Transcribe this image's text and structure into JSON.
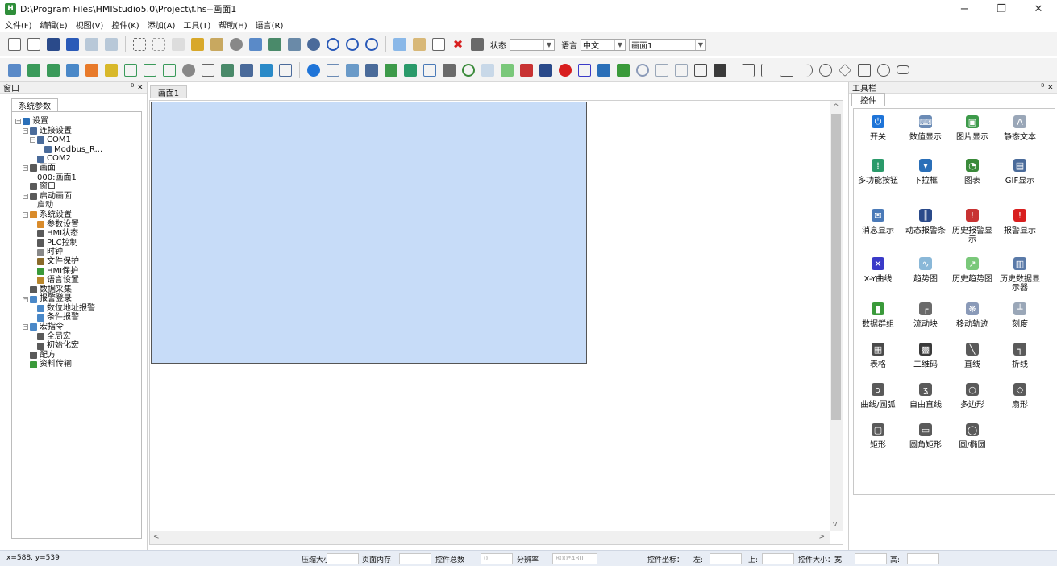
{
  "window": {
    "title": "D:\\Program Files\\HMIStudio5.0\\Project\\f.hs--画面1",
    "minimize": "−",
    "restore": "❐",
    "close": "✕"
  },
  "menu": [
    "文件(F)",
    "编辑(E)",
    "视图(V)",
    "控件(K)",
    "添加(A)",
    "工具(T)",
    "帮助(H)",
    "语言(R)"
  ],
  "toolbar1": {
    "state_label": "状态",
    "state_value": "",
    "lang_label": "语言",
    "lang_value": "中文",
    "screen_value": "画面1"
  },
  "left_panel": {
    "header": "窗口",
    "pin": "ᴮ ×",
    "tab": "系统参数",
    "tree": [
      {
        "label": "设置",
        "depth": 0,
        "exp": "−",
        "color": "#2a6fb8"
      },
      {
        "label": "连接设置",
        "depth": 1,
        "exp": "−",
        "color": "#4a6b9a"
      },
      {
        "label": "COM1",
        "depth": 2,
        "exp": "−",
        "color": "#4a6b9a"
      },
      {
        "label": "Modbus_R...",
        "depth": 3,
        "exp": "",
        "color": "#4a6b9a"
      },
      {
        "label": "COM2",
        "depth": 2,
        "exp": "",
        "color": "#4a6b9a"
      },
      {
        "label": "画面",
        "depth": 1,
        "exp": "−",
        "color": "#5a5a5a"
      },
      {
        "label": "000:画面1",
        "depth": 2,
        "exp": "",
        "color": ""
      },
      {
        "label": "窗口",
        "depth": 1,
        "exp": "",
        "color": "#5a5a5a"
      },
      {
        "label": "启动画面",
        "depth": 1,
        "exp": "−",
        "color": "#5a5a5a"
      },
      {
        "label": "启动",
        "depth": 2,
        "exp": "",
        "color": ""
      },
      {
        "label": "系统设置",
        "depth": 1,
        "exp": "−",
        "color": "#d98b2b"
      },
      {
        "label": "参数设置",
        "depth": 2,
        "exp": "",
        "color": "#d98b2b"
      },
      {
        "label": "HMI状态",
        "depth": 2,
        "exp": "",
        "color": "#5a5a5a"
      },
      {
        "label": "PLC控制",
        "depth": 2,
        "exp": "",
        "color": "#5a5a5a"
      },
      {
        "label": "时钟",
        "depth": 2,
        "exp": "",
        "color": "#888"
      },
      {
        "label": "文件保护",
        "depth": 2,
        "exp": "",
        "color": "#8a6a2a"
      },
      {
        "label": "HMI保护",
        "depth": 2,
        "exp": "",
        "color": "#3a9a3a"
      },
      {
        "label": "语言设置",
        "depth": 2,
        "exp": "",
        "color": "#b8862a"
      },
      {
        "label": "数据采集",
        "depth": 1,
        "exp": "",
        "color": "#5a5a5a"
      },
      {
        "label": "报警登录",
        "depth": 1,
        "exp": "−",
        "color": "#4a88c8"
      },
      {
        "label": "数位地址报警",
        "depth": 2,
        "exp": "",
        "color": "#4a88c8"
      },
      {
        "label": "条件报警",
        "depth": 2,
        "exp": "",
        "color": "#4a88c8"
      },
      {
        "label": "宏指令",
        "depth": 1,
        "exp": "−",
        "color": "#4a88c8"
      },
      {
        "label": "全局宏",
        "depth": 2,
        "exp": "",
        "color": "#5a5a5a"
      },
      {
        "label": "初始化宏",
        "depth": 2,
        "exp": "",
        "color": "#5a5a5a"
      },
      {
        "label": "配方",
        "depth": 1,
        "exp": "",
        "color": "#5a5a5a"
      },
      {
        "label": "资料传输",
        "depth": 1,
        "exp": "",
        "color": "#3a9a3a"
      }
    ]
  },
  "editor": {
    "tab": "画面1"
  },
  "right_panel": {
    "header": "工具栏",
    "pin": "ᴮ ×",
    "tab": "控件",
    "widgets": [
      {
        "label": "开关",
        "icon": "power-icon",
        "glyph": "⏻",
        "color": "#1e74d8"
      },
      {
        "label": "数值显示",
        "icon": "numeric-display-icon",
        "glyph": "⌨",
        "color": "#6b8bb5"
      },
      {
        "label": "图片显示",
        "icon": "picture-icon",
        "glyph": "▣",
        "color": "#3d9a4a"
      },
      {
        "label": "静态文本",
        "icon": "static-text-icon",
        "glyph": "A",
        "color": "#9aa7b8"
      },
      {
        "label": "多功能按钮",
        "icon": "multi-button-icon",
        "glyph": "⁞",
        "color": "#2a9a6a"
      },
      {
        "label": "下拉框",
        "icon": "dropdown-icon",
        "glyph": "▾",
        "color": "#2a6fb8"
      },
      {
        "label": "图表",
        "icon": "chart-icon",
        "glyph": "◔",
        "color": "#3a8a3a"
      },
      {
        "label": "GIF显示",
        "icon": "gif-icon",
        "glyph": "▤",
        "color": "#4a6b9a"
      },
      {
        "label": "消息显示",
        "icon": "message-icon",
        "glyph": "✉",
        "color": "#4a7ab8"
      },
      {
        "label": "动态报警条",
        "icon": "alarm-bar-icon",
        "glyph": "║",
        "color": "#2a4a8a"
      },
      {
        "label": "历史报警显示",
        "icon": "history-alarm-icon",
        "glyph": "!",
        "color": "#c83232"
      },
      {
        "label": "报警显示",
        "icon": "alarm-icon",
        "glyph": "!",
        "color": "#d81e1e"
      },
      {
        "label": "X-Y曲线",
        "icon": "xy-curve-icon",
        "glyph": "✕",
        "color": "#3a3ac8"
      },
      {
        "label": "趋势图",
        "icon": "trend-icon",
        "glyph": "∿",
        "color": "#8ab8d8"
      },
      {
        "label": "历史趋势图",
        "icon": "history-trend-icon",
        "glyph": "↗",
        "color": "#7ac87a"
      },
      {
        "label": "历史数据显示器",
        "icon": "history-data-icon",
        "glyph": "▥",
        "color": "#5a7aa8"
      },
      {
        "label": "数据群组",
        "icon": "data-group-icon",
        "glyph": "▮",
        "color": "#3a9a3a"
      },
      {
        "label": "流动块",
        "icon": "flow-block-icon",
        "glyph": "┌",
        "color": "#6a6a6a"
      },
      {
        "label": "移动轨迹",
        "icon": "move-track-icon",
        "glyph": "❋",
        "color": "#8a9ab8"
      },
      {
        "label": "刻度",
        "icon": "scale-icon",
        "glyph": "┴",
        "color": "#9aa7b8"
      },
      {
        "label": "表格",
        "icon": "table-icon",
        "glyph": "▦",
        "color": "#4a4a4a"
      },
      {
        "label": "二维码",
        "icon": "qrcode-icon",
        "glyph": "▩",
        "color": "#3a3a3a"
      },
      {
        "label": "直线",
        "icon": "line-icon",
        "glyph": "╲",
        "color": "#5a5a5a"
      },
      {
        "label": "折线",
        "icon": "polyline-icon",
        "glyph": "┐",
        "color": "#5a5a5a"
      },
      {
        "label": "曲线/圆弧",
        "icon": "arc-icon",
        "glyph": "ↄ",
        "color": "#5a5a5a"
      },
      {
        "label": "自由直线",
        "icon": "free-line-icon",
        "glyph": "ʓ",
        "color": "#5a5a5a"
      },
      {
        "label": "多边形",
        "icon": "polygon-icon",
        "glyph": "○",
        "color": "#5a5a5a"
      },
      {
        "label": "扇形",
        "icon": "sector-icon",
        "glyph": "◇",
        "color": "#5a5a5a"
      },
      {
        "label": "矩形",
        "icon": "rectangle-icon",
        "glyph": "▢",
        "color": "#5a5a5a"
      },
      {
        "label": "圆角矩形",
        "icon": "rounded-rect-icon",
        "glyph": "▭",
        "color": "#5a5a5a"
      },
      {
        "label": "圆/椭圆",
        "icon": "ellipse-icon",
        "glyph": "◯",
        "color": "#5a5a5a"
      }
    ]
  },
  "status": {
    "cursor": "x=588, y=539",
    "compress_label": "压缩大小",
    "compress_value": "",
    "page_mem_label": "页面内存",
    "page_mem_value": "",
    "total_label": "控件总数",
    "total_value": "0",
    "resolution_label": "分辨率",
    "resolution_value": "800*480",
    "coord_label": "控件坐标：",
    "left_label": "左:",
    "left_value": "",
    "top_label": "上:",
    "top_value": "",
    "size_label": "控件大小：宽:",
    "width_value": "",
    "height_label": "高:",
    "height_value": ""
  },
  "colors": {
    "canvas_screen": "#c7dcf8",
    "statusbar": "#e8edf5"
  }
}
